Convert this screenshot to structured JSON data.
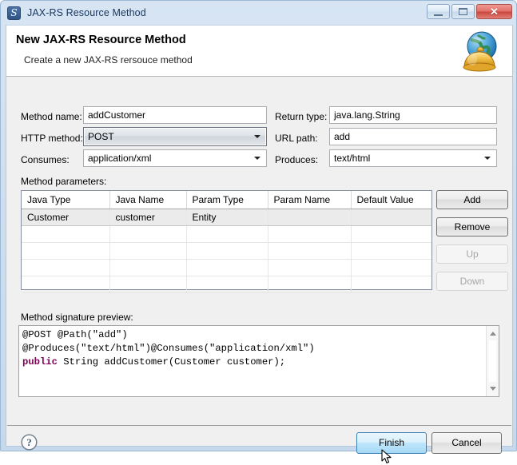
{
  "window": {
    "title": "JAX-RS Resource Method",
    "icon": "jaxrs-app-icon",
    "controls": {
      "minimize": "minimize-button",
      "maximize": "maximize-button",
      "close": "close-button"
    }
  },
  "banner": {
    "title": "New JAX-RS Resource Method",
    "subtitle": "Create a new JAX-RS rersouce method",
    "icon": "globe-bell-icon"
  },
  "form": {
    "method_name": {
      "label": "Method name:",
      "value": "addCustomer"
    },
    "return_type": {
      "label": "Return type:",
      "value": "java.lang.String"
    },
    "http_method": {
      "label": "HTTP method:",
      "value": "POST"
    },
    "url_path": {
      "label": "URL path:",
      "value": "add"
    },
    "consumes": {
      "label": "Consumes:",
      "value": "application/xml"
    },
    "produces": {
      "label": "Produces:",
      "value": "text/html"
    }
  },
  "parameters": {
    "label": "Method parameters:",
    "columns": [
      "Java Type",
      "Java Name",
      "Param Type",
      "Param Name",
      "Default Value"
    ],
    "rows": [
      {
        "java_type": "Customer",
        "java_name": "customer",
        "param_type": "Entity",
        "param_name": "",
        "default_value": "",
        "selected": true
      }
    ],
    "buttons": [
      {
        "label": "Add",
        "enabled": true
      },
      {
        "label": "Remove",
        "enabled": true
      },
      {
        "label": "Up",
        "enabled": false
      },
      {
        "label": "Down",
        "enabled": false
      }
    ]
  },
  "preview": {
    "label": "Method signature preview:",
    "line1": "@POST @Path(\"add\")",
    "line2": "@Produces(\"text/html\")@Consumes(\"application/xml\")",
    "line3_keyword": "public",
    "line3_rest": " String addCustomer(Customer customer);"
  },
  "footer": {
    "help": "help-icon",
    "finish": "Finish",
    "cancel": "Cancel"
  },
  "colors": {
    "titlebar_text": "#17365d",
    "keyword": "#7f0055",
    "selection": "#ebebeb",
    "hover_button_border": "#3c7fb1"
  }
}
